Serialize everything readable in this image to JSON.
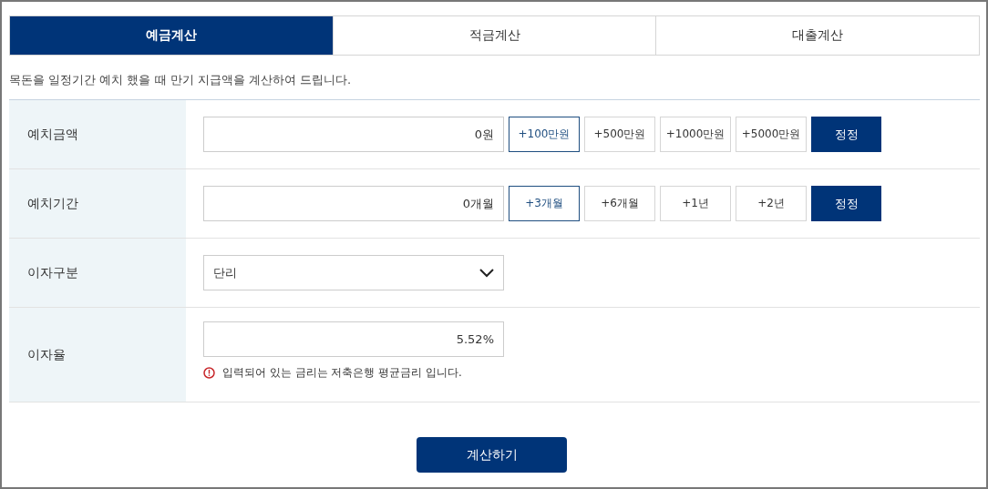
{
  "tabs": [
    {
      "label": "예금계산",
      "selected": true
    },
    {
      "label": "적금계산",
      "selected": false
    },
    {
      "label": "대출계산",
      "selected": false
    }
  ],
  "description": "목돈을 일정기간 예치 했을 때 만기 지급액을 계산하여 드립니다.",
  "rows": [
    {
      "kind": "input",
      "label": "예치금액",
      "value": "0원",
      "buttons": [
        {
          "label": "+100만원",
          "kind": "add",
          "selected": true
        },
        {
          "label": "+500만원",
          "kind": "add",
          "selected": false
        },
        {
          "label": "+1000만원",
          "kind": "add",
          "selected": false
        },
        {
          "label": "+5000만원",
          "kind": "add",
          "selected": false
        },
        {
          "label": "정정",
          "kind": "reset"
        }
      ]
    },
    {
      "kind": "input",
      "label": "예치기간",
      "value": "0개월",
      "buttons": [
        {
          "label": "+3개월",
          "kind": "add",
          "selected": true
        },
        {
          "label": "+6개월",
          "kind": "add",
          "selected": false
        },
        {
          "label": "+1년",
          "kind": "add",
          "selected": false
        },
        {
          "label": "+2년",
          "kind": "add",
          "selected": false
        },
        {
          "label": "정정",
          "kind": "reset"
        }
      ]
    },
    {
      "kind": "select",
      "label": "이자구분",
      "value": "단리"
    },
    {
      "kind": "rate",
      "label": "이자율",
      "value": "5.52%",
      "note": "입력되어 있는 금리는 저축은행 평균금리 입니다."
    }
  ],
  "submit": "계산하기"
}
